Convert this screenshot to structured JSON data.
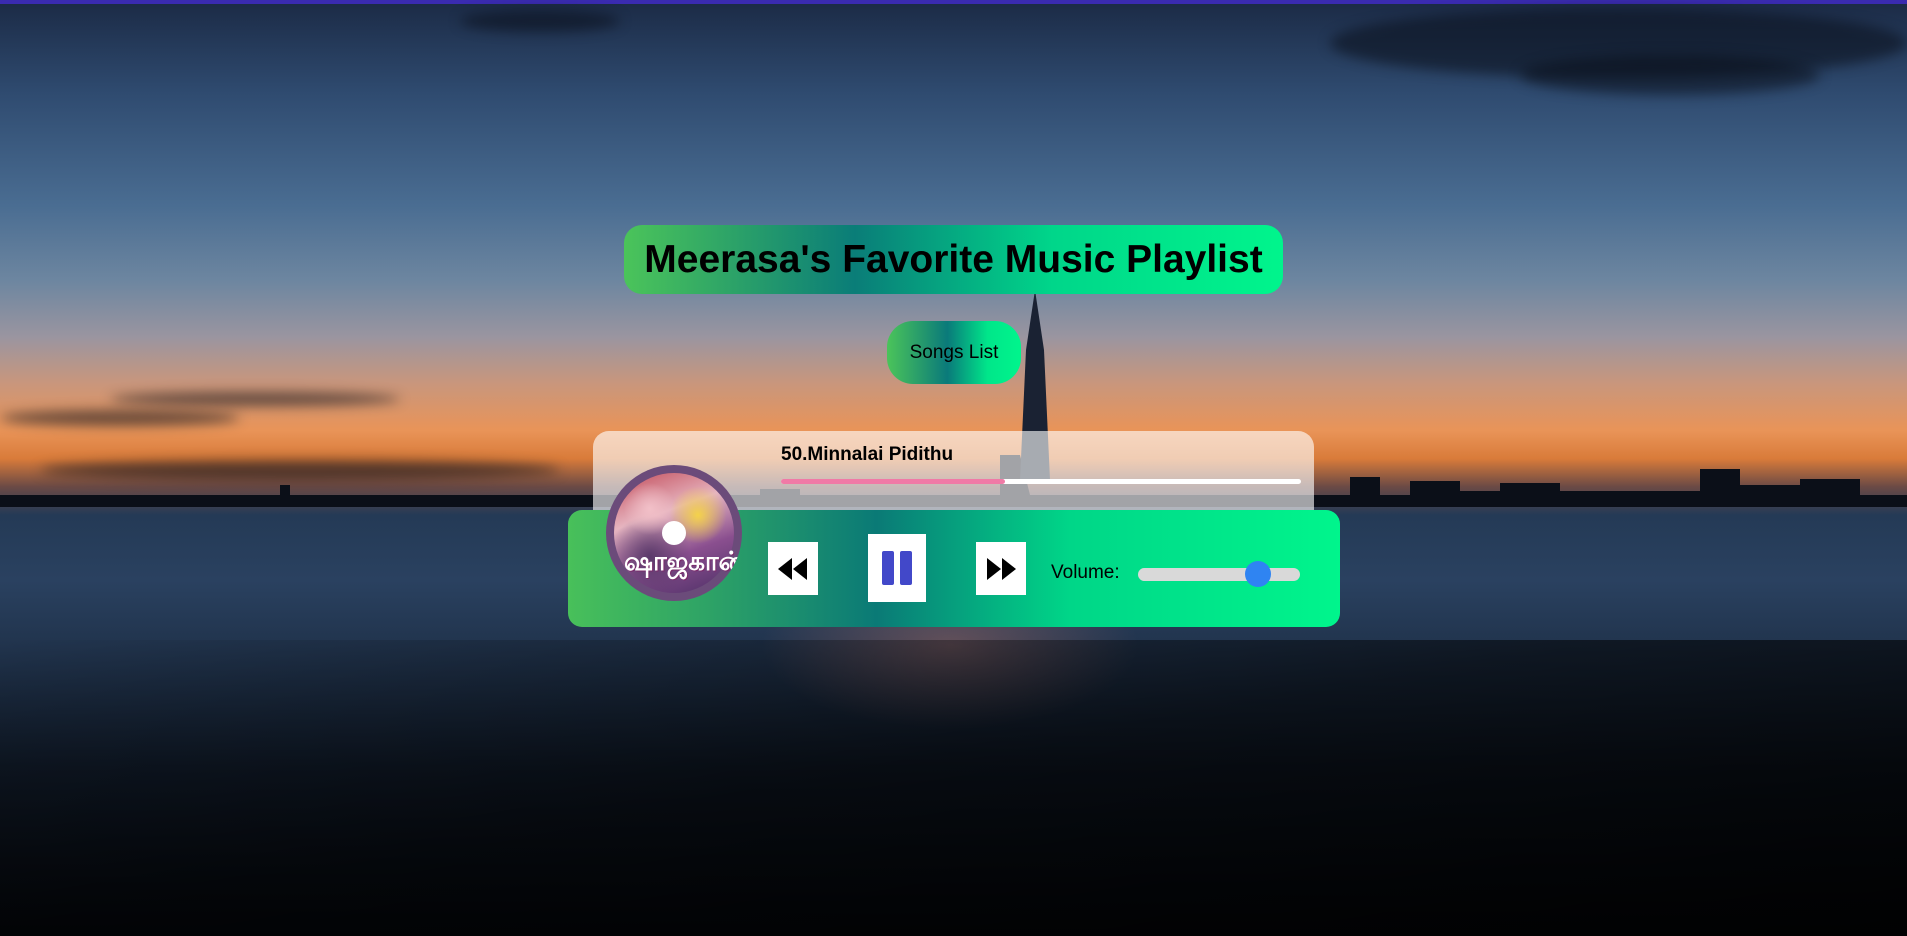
{
  "page": {
    "title": "Meerasa's Favorite Music Playlist",
    "songs_button_label": "Songs List"
  },
  "player": {
    "track_title": "50.Minnalai Pidithu",
    "progress_fraction": 0.43,
    "album_art_text": "ஷாஜகான்",
    "controls": {
      "prev_icon": "rewind-icon",
      "play_state_icon": "pause-icon",
      "next_icon": "fast-forward-icon"
    },
    "volume_label": "Volume:",
    "volume_fraction": 0.74
  },
  "colors": {
    "gradient_green": "#4bc45a",
    "gradient_teal": "#0a7d78",
    "gradient_mint": "#00f58c",
    "progress_fill": "#f07aa6",
    "pause_icon": "#4248c9",
    "volume_thumb": "#2f84f2"
  }
}
